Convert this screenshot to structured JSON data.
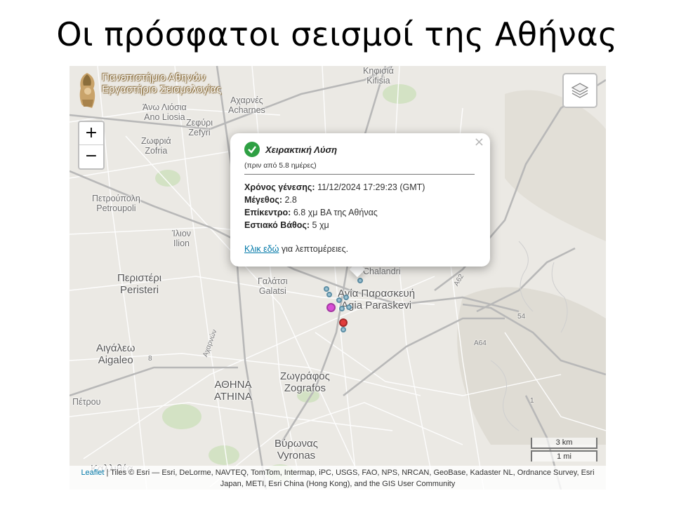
{
  "slide": {
    "title": "Οι πρόσφατοι σεισμοί της Αθήνας"
  },
  "logo": {
    "line1": "Πανεπιστήμιο Αθηνών",
    "line2": "Εργαστήριο Σεισμολογίας"
  },
  "zoom": {
    "in_label": "+",
    "out_label": "−"
  },
  "places": {
    "kifisia": {
      "greek": "Κηφισιά",
      "latin": "Kifisia"
    },
    "acharnes": {
      "greek": "Αχαρνές",
      "latin": "Acharnes"
    },
    "ano_liosia": {
      "greek": "Άνω Λιόσια",
      "latin": "Ano Liosia"
    },
    "zefyri": {
      "greek": "Ζεφύρι",
      "latin": "Zefyri"
    },
    "zofria": {
      "greek": "Ζωφριά",
      "latin": "Zofria"
    },
    "petroupoli": {
      "greek": "Πετρούπολη",
      "latin": "Petroupoli"
    },
    "ilion": {
      "greek": "Ίλιον",
      "latin": "Ilion"
    },
    "peristeri": {
      "greek": "Περιστέρι",
      "latin": "Peristeri"
    },
    "galatsi": {
      "greek": "Γαλάτσι",
      "latin": "Galatsi"
    },
    "agia_paraskevi": {
      "greek": "Αγία Παρασκευή",
      "latin": "Agia Paraskevi"
    },
    "chalandri": {
      "latin": "Chalandri"
    },
    "aigaleo": {
      "greek": "Αιγάλεω",
      "latin": "Aigaleo"
    },
    "athina": {
      "greek": "ΑΘΗΝΑ",
      "latin": "ATHINA"
    },
    "zografos": {
      "greek": "Ζωγράφος",
      "latin": "Zografos"
    },
    "petrou": {
      "greek": "Πέτρου"
    },
    "vyronas": {
      "greek": "Βύρωνας",
      "latin": "Vyronas"
    },
    "kallithea": {
      "greek": "Καλλιθέα"
    }
  },
  "roads": {
    "a62": "A62",
    "a64": "A64",
    "r54": "54",
    "r1": "1",
    "ae": "Αχαρνών",
    "r8": "8"
  },
  "popup": {
    "status": "Χειρακτική Λύση",
    "age": "(πριν από 5.8 ημέρες)",
    "origin_label": "Χρόνος γένεσης:",
    "origin_value": "11/12/2024 17:29:23 (GMT)",
    "magnitude_label": "Μέγεθος:",
    "magnitude_value": "2.8",
    "epicenter_label": "Επίκεντρο:",
    "epicenter_value": "6.8 χμ ΒΑ της Αθήνας",
    "depth_label": "Εστιακό Βάθος:",
    "depth_value": "5 χμ",
    "link_text": "Κλικ εδώ",
    "link_suffix": "για λεπτομέρειες.",
    "close_label": "×"
  },
  "scale": {
    "km": "3 km",
    "mi": "1 mi"
  },
  "attribution": {
    "leaflet": "Leaflet",
    "text": "| Tiles © Esri — Esri, DeLorme, NAVTEQ, TomTom, Intermap, iPC, USGS, FAO, NPS, NRCAN, GeoBase, Kadaster NL, Ordnance Survey, Esri Japan, METI, Esri China (Hong Kong), and the GIS User Community"
  },
  "colors": {
    "map_bg": "#ebe9e4",
    "road": "#ffffff",
    "highway": "#bdbdbd",
    "park": "#d3e2c4",
    "quake_recent": "#e03c3c",
    "quake_selected": "#d94fd6",
    "quake_old": "#7ea3b5",
    "check": "#2ea043",
    "link": "#0078a8"
  }
}
